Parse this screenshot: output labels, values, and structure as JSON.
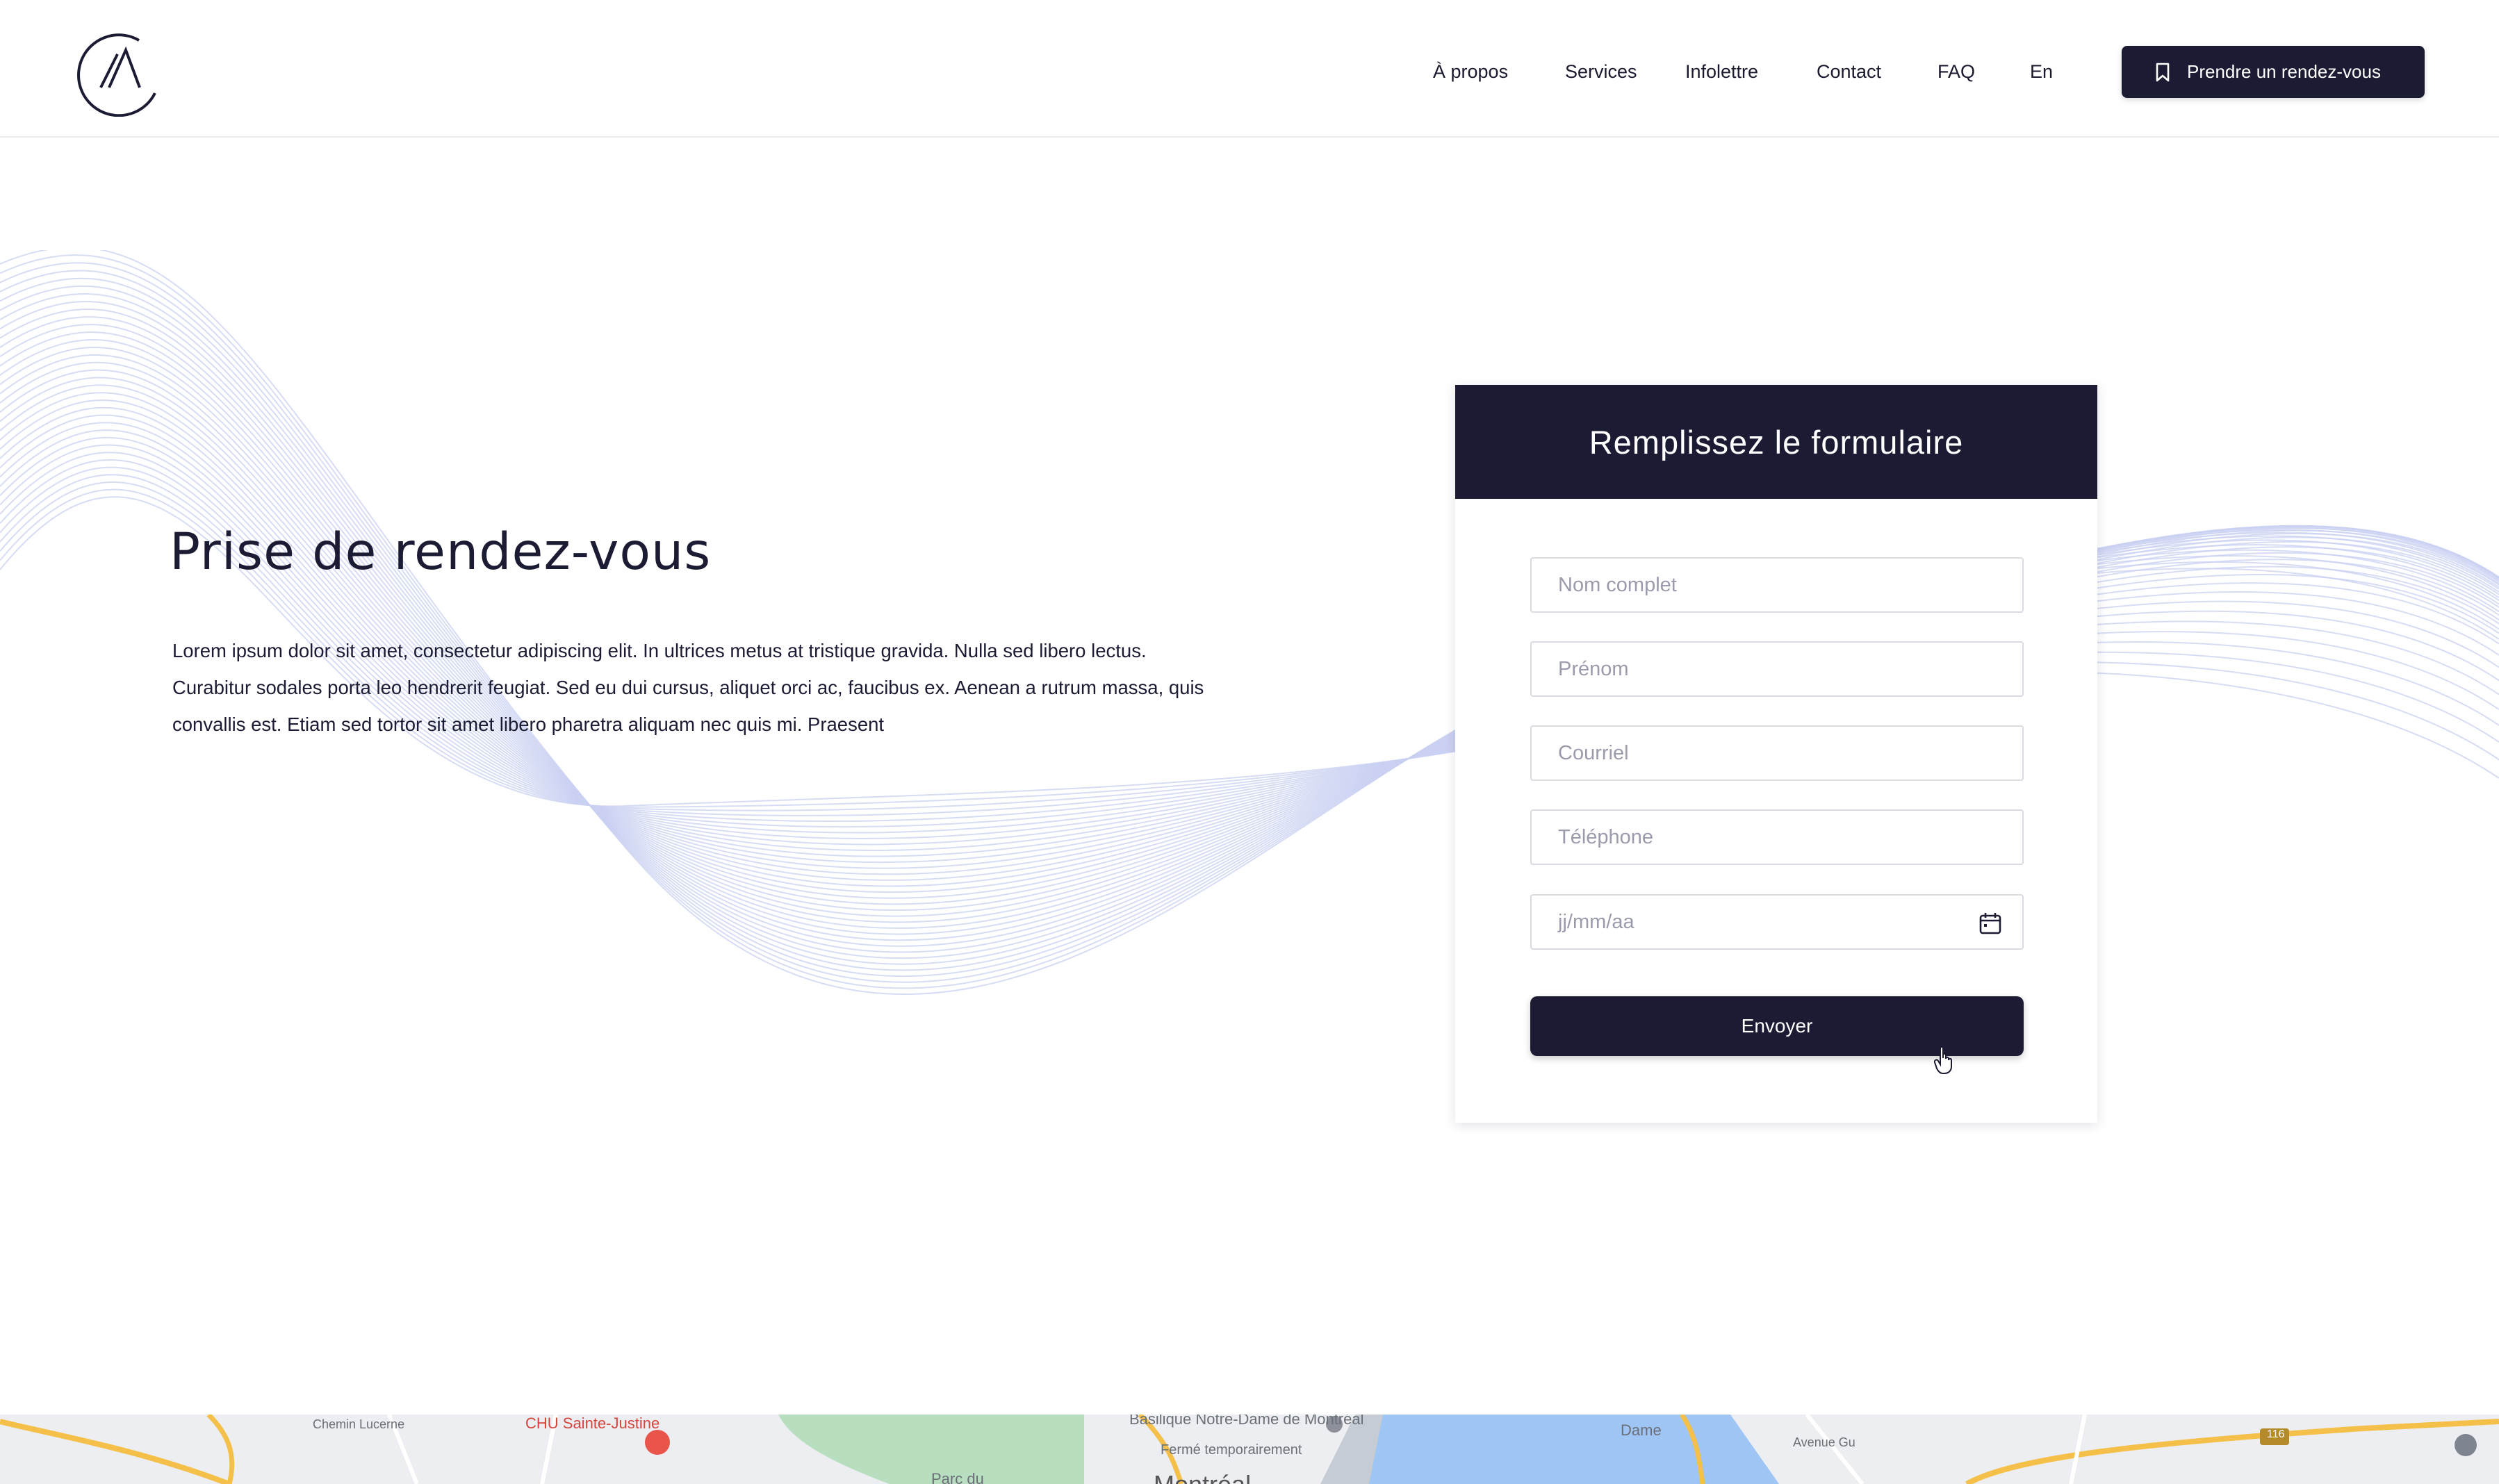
{
  "header": {
    "nav": [
      "À propos",
      "Services",
      "Infolettre",
      "Contact",
      "FAQ",
      "En"
    ],
    "cta_label": "Prendre un rendez-vous"
  },
  "hero": {
    "title": "Prise de rendez-vous",
    "body": "Lorem ipsum dolor sit amet, consectetur adipiscing elit. In ultrices metus at tristique gravida. Nulla sed libero lectus. Curabitur sodales porta leo hendrerit feugiat. Sed eu dui cursus, aliquet orci ac, faucibus ex. Aenean a rutrum massa, quis convallis est. Etiam sed tortor sit amet libero pharetra aliquam nec quis mi. Praesent"
  },
  "form": {
    "title": "Remplissez le formulaire",
    "fields": {
      "fullname_placeholder": "Nom complet",
      "firstname_placeholder": "Prénom",
      "email_placeholder": "Courriel",
      "phone_placeholder": "Téléphone",
      "date_placeholder": "jj/mm/aa"
    },
    "submit_label": "Envoyer"
  },
  "map": {
    "labels": [
      "CHU Sainte-Justine",
      "Chemin Lucerne",
      "Basilique Notre-Dame de Montréal",
      "Fermé temporairement",
      "Dame",
      "Avenue Gu",
      "116",
      "Parc du",
      "Montréal"
    ]
  },
  "colors": {
    "primary": "#1b1c33",
    "wave": "#c9d0f2",
    "border": "#d9dbe2"
  },
  "icons": {
    "logo": "circle-a-logo",
    "cta": "bookmark-icon",
    "date": "calendar-icon",
    "pointer": "hand-cursor-icon"
  }
}
